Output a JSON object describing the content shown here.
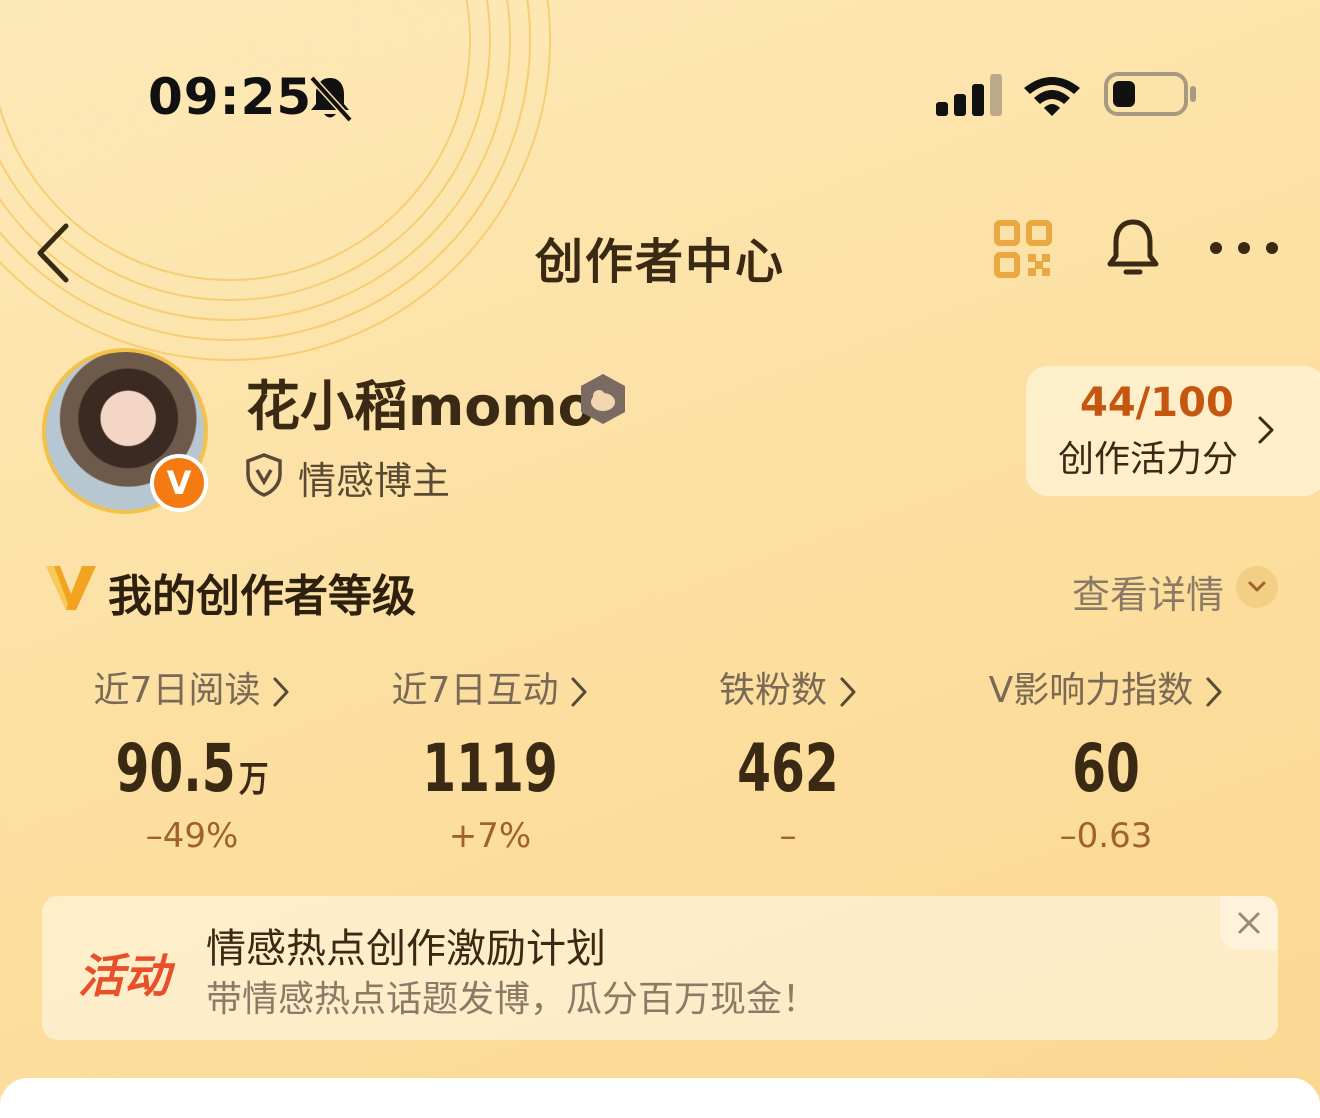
{
  "status_bar": {
    "time": "09:25"
  },
  "nav": {
    "title": "创作者中心"
  },
  "profile": {
    "username": "花小稻momo",
    "role": "情感博主",
    "verified_mark": "V"
  },
  "activity_score": {
    "value": "44/100",
    "label": "创作活力分"
  },
  "level": {
    "title": "我的创作者等级",
    "detail_link": "查看详情"
  },
  "stats": [
    {
      "label": "近7日阅读",
      "value": "90.5",
      "unit": "万",
      "change": "–49%"
    },
    {
      "label": "近7日互动",
      "value": "1119",
      "unit": "",
      "change": "+7%"
    },
    {
      "label": "铁粉数",
      "value": "462",
      "unit": "",
      "change": "–"
    },
    {
      "label": "V影响力指数",
      "value": "60",
      "unit": "",
      "change": "–0.63"
    }
  ],
  "banner": {
    "tag": "活动",
    "title": "情感热点创作激励计划",
    "subtitle": "带情感热点话题发博，瓜分百万现金！"
  },
  "colors": {
    "accent": "#c4560f",
    "tag": "#e8502a",
    "background": "#fde9b8",
    "verified": "#f47a12"
  },
  "icons": [
    "bell-off-icon",
    "signal-icon",
    "wifi-icon",
    "battery-icon",
    "back-icon",
    "qr-code-icon",
    "bell-icon",
    "more-icon",
    "badge-icon",
    "shield-icon",
    "chevron-right-icon",
    "v-level-icon",
    "chevron-down-icon",
    "close-icon"
  ]
}
